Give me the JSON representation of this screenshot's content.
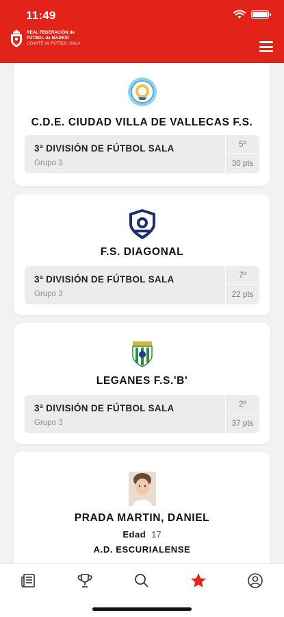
{
  "status_bar": {
    "time": "11:49"
  },
  "header": {
    "logo_lines": [
      "REAL FEDERACIÓN de",
      "FÚTBOL de MADRID",
      "COMITÉ de FÚTBOL SALA"
    ],
    "brand_color": "#e2231a"
  },
  "cards": [
    {
      "team": "C.D.E. CIUDAD VILLA DE VALLECAS F.S.",
      "competition": "3ª DIVISIÓN DE FÚTBOL SALA",
      "group": "Grupo 3",
      "position": "5º",
      "points": "30 pts"
    },
    {
      "team": "F.S. DIAGONAL",
      "competition": "3ª DIVISIÓN DE FÚTBOL SALA",
      "group": "Grupo 3",
      "position": "7º",
      "points": "22 pts"
    },
    {
      "team": "LEGANES F.S.'B'",
      "competition": "3ª DIVISIÓN DE FÚTBOL SALA",
      "group": "Grupo 3",
      "position": "2º",
      "points": "37 pts"
    }
  ],
  "player": {
    "name": "PRADA MARTIN, DANIEL",
    "age_label": "Edad",
    "age": "17",
    "club": "A.D. ESCURIALENSE"
  },
  "tabs": [
    {
      "icon": "news-icon",
      "active": false
    },
    {
      "icon": "trophy-icon",
      "active": false
    },
    {
      "icon": "search-icon",
      "active": false
    },
    {
      "icon": "star-icon",
      "active": true
    },
    {
      "icon": "user-icon",
      "active": false
    }
  ]
}
